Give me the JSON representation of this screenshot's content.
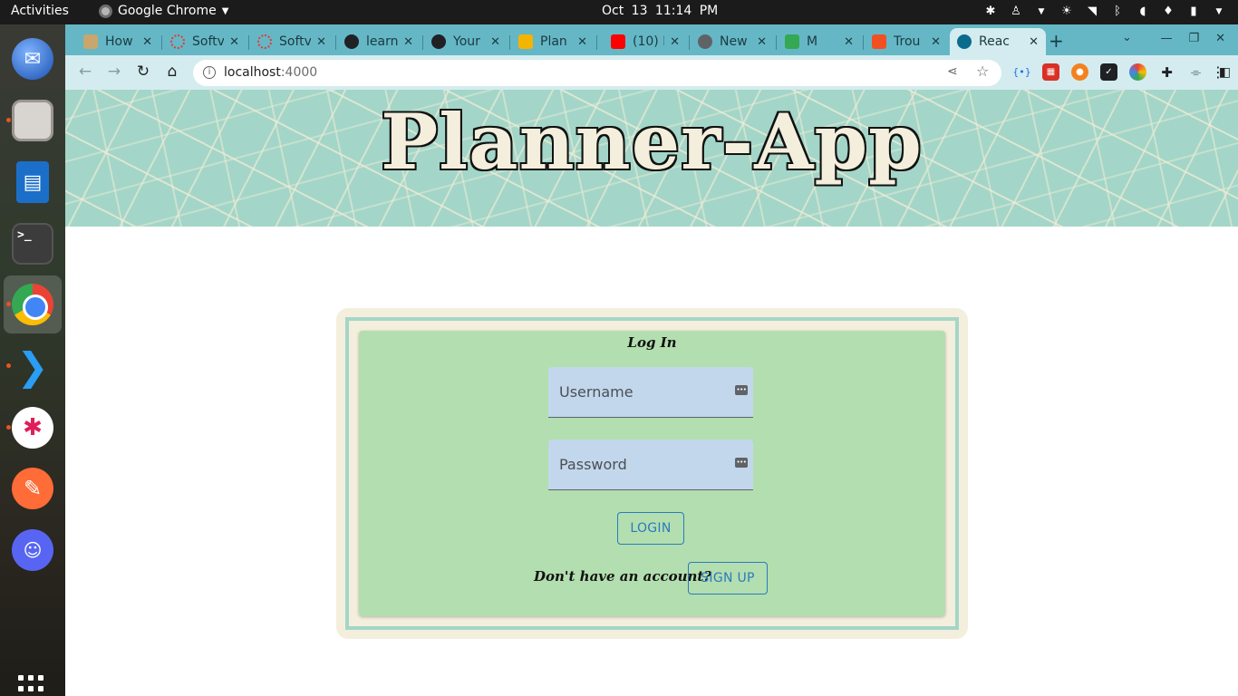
{
  "system_bar": {
    "activities": "Activities",
    "app_name": "Google Chrome",
    "clock": "Oct 13  11:14 PM"
  },
  "browser": {
    "tabs": [
      {
        "title": "How",
        "favicon": "document-icon",
        "color": "#c9a66b"
      },
      {
        "title": "Softv",
        "favicon": "loading-spinner-icon",
        "color": "#e53935"
      },
      {
        "title": "Softv",
        "favicon": "loading-spinner-icon",
        "color": "#e53935"
      },
      {
        "title": "learn",
        "favicon": "github-icon",
        "color": "#202124"
      },
      {
        "title": "Your",
        "favicon": "github-icon",
        "color": "#202124"
      },
      {
        "title": "Plan",
        "favicon": "slides-icon",
        "color": "#f4b400"
      },
      {
        "title": "(10) I",
        "favicon": "youtube-icon",
        "color": "#ff0000"
      },
      {
        "title": "New",
        "favicon": "chrome-icon",
        "color": "#5f6368"
      },
      {
        "title": "M",
        "favicon": "maps-icon",
        "color": "#34a853"
      },
      {
        "title": "Trou",
        "favicon": "microsoft-icon",
        "color": "#f25022"
      },
      {
        "title": "Reac",
        "favicon": "react-icon",
        "color": "#0a6c8c"
      }
    ],
    "url_host": "localhost",
    "url_port": ":4000"
  },
  "page": {
    "site_title": "Planner-App",
    "login": {
      "heading": "Log In",
      "username_placeholder": "Username",
      "password_placeholder": "Password",
      "login_label": "LOGIN",
      "signup_prompt": "Don't have an account?",
      "signup_label": "SIGN UP"
    }
  },
  "colors": {
    "banner": "#a3d6c8",
    "card_outer": "#f4eedd",
    "card_inner": "#b3deaf",
    "input_fill": "#c3d7ec",
    "button_accent": "#2a7bbf",
    "tab_strip": "#65b7c6",
    "toolbar": "#d4ecef"
  }
}
